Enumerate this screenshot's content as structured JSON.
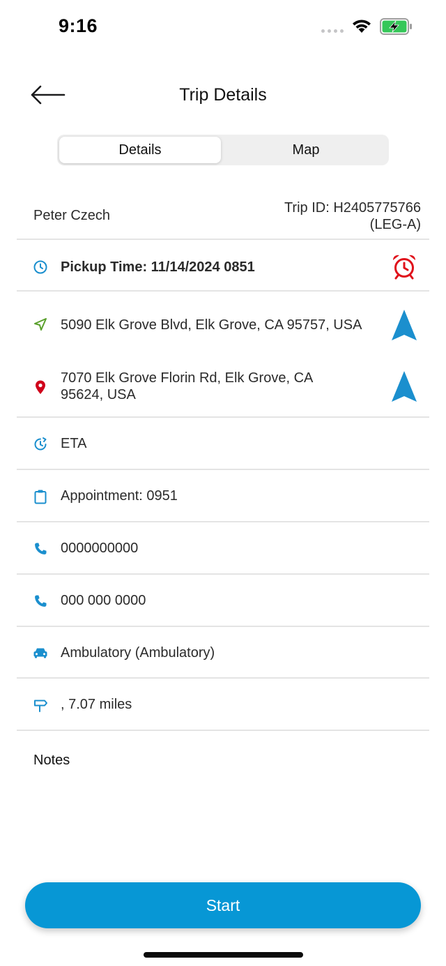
{
  "status_bar": {
    "time": "9:16"
  },
  "header": {
    "title": "Trip Details"
  },
  "tabs": [
    {
      "label": "Details",
      "active": true
    },
    {
      "label": "Map",
      "active": false
    }
  ],
  "trip": {
    "rider_name": "Peter Czech",
    "trip_id_line1": "Trip ID: H2405775766",
    "trip_id_line2": "(LEG-A)"
  },
  "rows": {
    "pickup_time": "Pickup Time: 11/14/2024 0851",
    "pickup_address": "5090 Elk Grove Blvd, Elk Grove, CA 95757, USA",
    "dropoff_address_line1": "7070 Elk Grove Florin Rd, Elk Grove, CA",
    "dropoff_address_line2": "95624, USA",
    "eta": "ETA",
    "appointment": "Appointment: 0951",
    "phone_primary": "0000000000",
    "phone_secondary": "000 000 0000",
    "vehicle_type": "Ambulatory (Ambulatory)",
    "distance": ", 7.07 miles"
  },
  "notes": {
    "label": "Notes"
  },
  "actions": {
    "start_label": "Start"
  },
  "colors": {
    "accent": "#0797d5",
    "icon_blue": "#1b8fce",
    "pickup_green": "#5aa02c",
    "dropoff_red": "#d0021b",
    "alarm_red": "#e0121b"
  },
  "icons": {
    "pickup_time": "clock-icon",
    "alarm": "alarm-clock-icon",
    "pickup": "navigation-arrow-icon",
    "dropoff": "map-pin-icon",
    "navigate": "navigate-triangle-icon",
    "eta": "clock-refresh-icon",
    "appointment": "clipboard-icon",
    "phone": "phone-icon",
    "vehicle": "car-icon",
    "distance": "signpost-icon"
  }
}
